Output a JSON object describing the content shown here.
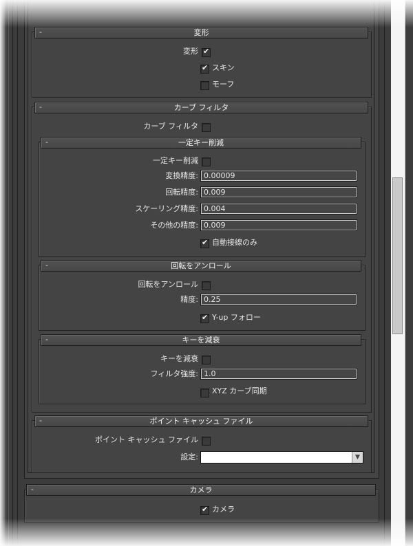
{
  "rollouts": {
    "deform": {
      "title": "変形",
      "collapse_glyph": "-",
      "deform_label": "変形",
      "deform_checked": true,
      "skin_label": "スキン",
      "skin_checked": true,
      "morph_label": "モーフ",
      "morph_checked": false
    },
    "curve_filter": {
      "title": "カーブ フィルタ",
      "collapse_glyph": "-",
      "enable_label": "カーブ フィルタ",
      "enable_checked": false,
      "constant_key": {
        "title": "一定キー削減",
        "collapse_glyph": "-",
        "enable_label": "一定キー削減",
        "enable_checked": false,
        "translation_label": "変換精度:",
        "translation_value": "0.00009",
        "rotation_label": "回転精度:",
        "rotation_value": "0.009",
        "scaling_label": "スケーリング精度:",
        "scaling_value": "0.004",
        "other_label": "その他の精度:",
        "other_value": "0.009",
        "auto_tangent_label": "自動接線のみ",
        "auto_tangent_checked": true
      },
      "unroll": {
        "title": "回転をアンロール",
        "collapse_glyph": "-",
        "enable_label": "回転をアンロール",
        "enable_checked": false,
        "precision_label": "精度:",
        "precision_value": "0.25",
        "yup_label": "Y-up フォロー",
        "yup_checked": true
      },
      "key_reducer": {
        "title": "キーを減衰",
        "collapse_glyph": "-",
        "enable_label": "キーを減衰",
        "enable_checked": false,
        "strength_label": "フィルタ強度:",
        "strength_value": "1.0",
        "xyz_label": "XYZ カーブ同期",
        "xyz_checked": false
      }
    },
    "point_cache": {
      "title": "ポイント キャッシュ ファイル",
      "collapse_glyph": "-",
      "enable_label": "ポイント キャッシュ ファイル",
      "enable_checked": false,
      "settings_label": "設定:",
      "settings_value": ""
    },
    "camera": {
      "title": "カメラ",
      "collapse_glyph": "-",
      "camera_label": "カメラ",
      "camera_checked": true
    }
  },
  "icons": {
    "check": "✔",
    "dropdown": "▼"
  },
  "colors": {
    "panel_bg": "#444444",
    "header_bg": "#4d4d4d",
    "text": "#e6e6e6",
    "field_border": "#c8c8c8"
  }
}
